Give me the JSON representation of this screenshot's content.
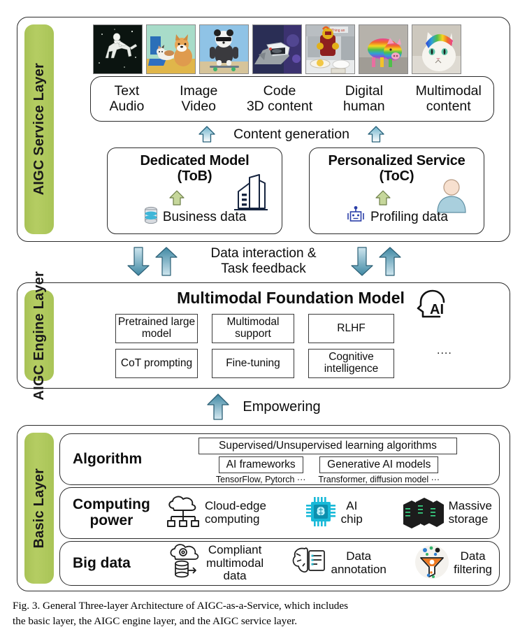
{
  "service_layer": {
    "label": "AIGC Service Layer",
    "thumbnails": [
      {
        "name": "astronaut-riding-horse",
        "alt": "astronaut riding a horse in space"
      },
      {
        "name": "cat-and-corgi-painting",
        "alt": "cat and corgi at a desk painting"
      },
      {
        "name": "panda-skateboarding",
        "alt": "panda in sunglasses skateboarding"
      },
      {
        "name": "dog-in-helmet",
        "alt": "dog wearing a futuristic helmet"
      },
      {
        "name": "robot-cooking",
        "alt": "robot cooking in a kitchen"
      },
      {
        "name": "rainbow-pig",
        "alt": "rainbow striped pig"
      },
      {
        "name": "rainbow-hair-cat",
        "alt": "white cat with rainbow hair"
      }
    ],
    "modalities": [
      {
        "top": "Text",
        "bottom": "Audio"
      },
      {
        "top": "Image",
        "bottom": "Video"
      },
      {
        "top": "Code",
        "bottom": "3D content"
      },
      {
        "top": "Digital",
        "bottom": "human"
      },
      {
        "top": "Multimodal",
        "bottom": "content"
      }
    ],
    "content_generation_label": "Content generation",
    "boxes": [
      {
        "title_line1": "Dedicated Model",
        "title_line2": "(ToB)",
        "sub_label": "Business data",
        "sub_icon": "database-icon",
        "side_icon": "office-building-icon"
      },
      {
        "title_line1": "Personalized Service",
        "title_line2": "(ToC)",
        "sub_label": "Profiling data",
        "sub_icon": "robot-icon",
        "side_icon": "user-avatar-icon"
      }
    ]
  },
  "mid_band": {
    "line1": "Data interaction &",
    "line2": "Task feedback"
  },
  "engine_layer": {
    "label": "AIGC Engine Layer",
    "title": "Multimodal Foundation Model",
    "head_icon": "ai-head-icon",
    "head_icon_text": "AI",
    "chips": [
      "Pretrained large model",
      "Multimodal support",
      "RLHF",
      "CoT prompting",
      "Fine-tuning",
      "Cognitive intelligence"
    ],
    "ellipsis": "...."
  },
  "empowering": {
    "label": "Empowering"
  },
  "basic_layer": {
    "label": "Basic Layer",
    "algorithm": {
      "row_label": "Algorithm",
      "top_box": "Supervised/Unsupervised learning algorithms",
      "cells": [
        {
          "box": "AI frameworks",
          "caption": "TensorFlow, Pytorch ···"
        },
        {
          "box": "Generative AI models",
          "caption": "Transformer,  diffusion model ···"
        }
      ]
    },
    "computing": {
      "row_label_line1": "Computing",
      "row_label_line2": "power",
      "items": [
        {
          "icon": "cloud-edge-icon",
          "line1": "Cloud-edge",
          "line2": "computing"
        },
        {
          "icon": "ai-chip-icon",
          "line1": "AI",
          "line2": "chip"
        },
        {
          "icon": "server-rack-icon",
          "line1": "Massive",
          "line2": "storage"
        }
      ]
    },
    "bigdata": {
      "row_label": "Big data",
      "items": [
        {
          "icon": "cloud-database-icon",
          "line1": "Compliant",
          "line2": "multimodal",
          "line3": "data"
        },
        {
          "icon": "brain-document-icon",
          "line1": "Data",
          "line2": "annotation"
        },
        {
          "icon": "funnel-icon",
          "line1": "Data",
          "line2": "filtering"
        }
      ]
    }
  },
  "caption": {
    "line1": "Fig. 3.  General Three-layer Architecture of AIGC-as-a-Service, which includes",
    "line2": "the basic layer, the AIGC engine layer, and the AIGC service layer."
  },
  "colors": {
    "layer_label_green": "#a9c457",
    "arrow_blue": "#4e9cb3",
    "arrow_green": "#b9cd8a",
    "border_dark": "#2b2b2b"
  }
}
